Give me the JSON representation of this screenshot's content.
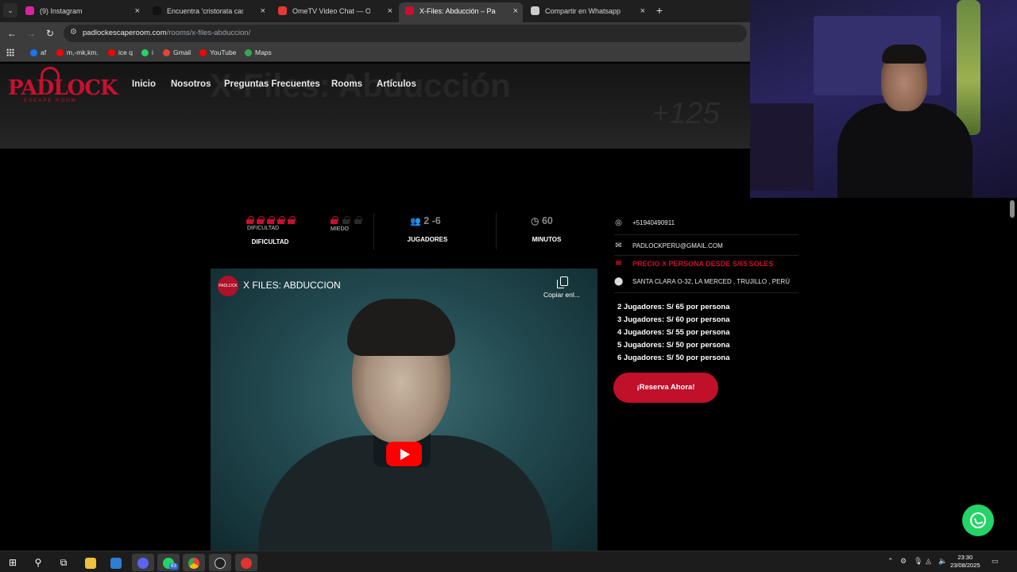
{
  "browser": {
    "tab_menu_glyph": "⌄",
    "tabs": [
      {
        "title": "(9) Instagram",
        "color": "#d6249f",
        "active": false
      },
      {
        "title": "Encuentra 'cristorata casa del te",
        "color": "#111111",
        "active": false
      },
      {
        "title": "OmeTV Video Chat — Omegle",
        "color": "#e53935",
        "active": false
      },
      {
        "title": "X-Files: Abducción – Padlock Es",
        "color": "#c8102e",
        "active": true
      },
      {
        "title": "Compartir en Whatsapp",
        "color": "#cccccc",
        "active": false
      }
    ],
    "close_glyph": "×",
    "newtab_glyph": "+",
    "url_host": "padlockescaperoom.com",
    "url_path": "/rooms/x-files-abduccion/",
    "bookmarks": [
      {
        "label": "af",
        "color": "#1877f2"
      },
      {
        "label": "m,-mk,km.",
        "color": "#ff0000"
      },
      {
        "label": "ice q",
        "color": "#ff0000"
      },
      {
        "label": "i",
        "color": "#25d366"
      },
      {
        "label": "Gmail",
        "color": "#ea4335"
      },
      {
        "label": "YouTube",
        "color": "#ff0000"
      },
      {
        "label": "Maps",
        "color": "#34a853"
      }
    ]
  },
  "site": {
    "logo_text": "PADLOCK",
    "logo_sub": "ESCAPE ROOM",
    "nav": [
      "Inicio",
      "Nosotros",
      "Preguntas Frecuentes",
      "Rooms",
      "Artículos"
    ],
    "hero_title": "X-Files: Abducción",
    "hero_number": "+125",
    "stats": {
      "difficulty_label": "DIFICULTAD",
      "difficulty_title": "DIFICULTAD",
      "difficulty_level": 5,
      "difficulty_max": 5,
      "fear_label": "MIEDO",
      "fear_level": 1,
      "fear_max": 3,
      "players_value": "2 -6",
      "players_title": "JUGADORES",
      "minutes_value": "60",
      "minutes_title": "MINUTOS"
    },
    "video": {
      "channel_badge": "PADLOCK",
      "title": "X FILES: ABDUCCION",
      "copy_label": "Copiar enl..."
    },
    "info": {
      "phone": "+51940490911",
      "email": "PADLOCKPERU@GMAIL.COM",
      "price_title": "PRECIO X PERSONA DESDE S/65 SOLES",
      "address": "SANTA CLARA O-32, LA MERCED , TRUJILLO , PERÚ"
    },
    "prices": [
      "2 Jugadores: S/ 65 por persona",
      "3 Jugadores: S/ 60 por persona",
      "4 Jugadores: S/ 55 por persona",
      "5 Jugadores: S/ 50 por persona",
      "6 Jugadores: S/ 50 por persona"
    ],
    "reserve_label": "¡Reserva Ahora!",
    "accent_color": "#c8102e"
  },
  "taskbar": {
    "whatsapp_badge": "63",
    "time": "23:30",
    "date": "23/08/2025"
  }
}
